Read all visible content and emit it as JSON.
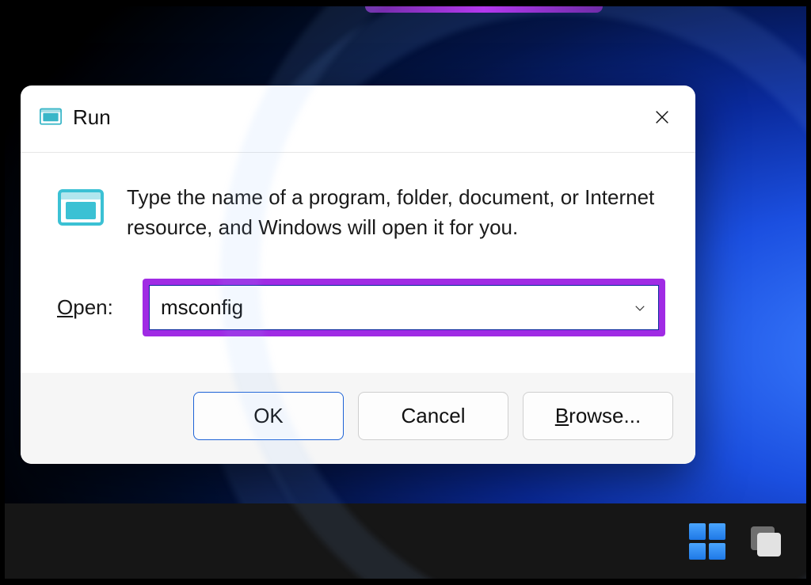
{
  "dialog": {
    "title": "Run",
    "instruction": "Type the name of a program, folder, document, or Internet resource, and Windows will open it for you.",
    "open_label_prefix": "O",
    "open_label_rest": "pen:",
    "input_value": "msconfig",
    "buttons": {
      "ok": "OK",
      "cancel": "Cancel",
      "browse_prefix": "B",
      "browse_rest": "rowse..."
    }
  },
  "highlight_color": "#a02be4"
}
